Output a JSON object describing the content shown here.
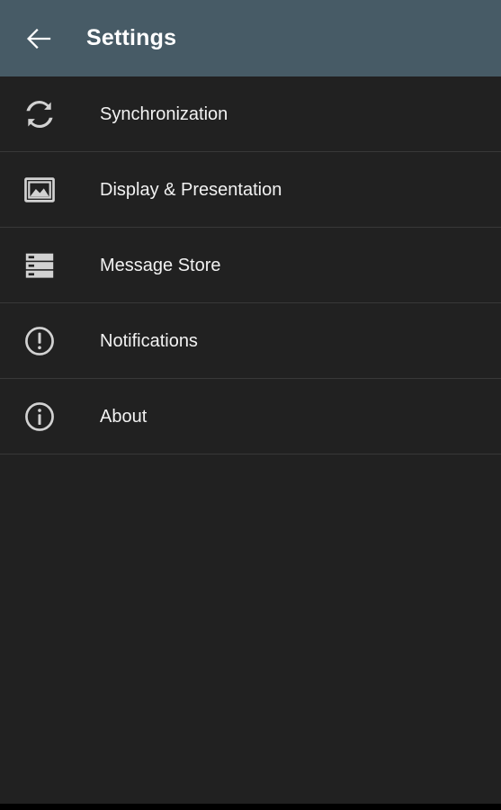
{
  "appbar": {
    "back_icon": "arrow-left-icon",
    "title": "Settings",
    "background_color": "#475b66",
    "title_color": "#ffffff"
  },
  "theme": {
    "background_color": "#212121",
    "divider_color": "#383838",
    "icon_color": "#d2d2d2",
    "label_color": "#f2f2f2",
    "bottom_strip_color": "#000000"
  },
  "list": {
    "items": [
      {
        "icon": "sync-icon",
        "label": "Synchronization"
      },
      {
        "icon": "image-icon",
        "label": "Display & Presentation"
      },
      {
        "icon": "message-store-icon",
        "label": "Message Store"
      },
      {
        "icon": "alert-circle-icon",
        "label": "Notifications"
      },
      {
        "icon": "info-circle-icon",
        "label": "About"
      }
    ]
  }
}
